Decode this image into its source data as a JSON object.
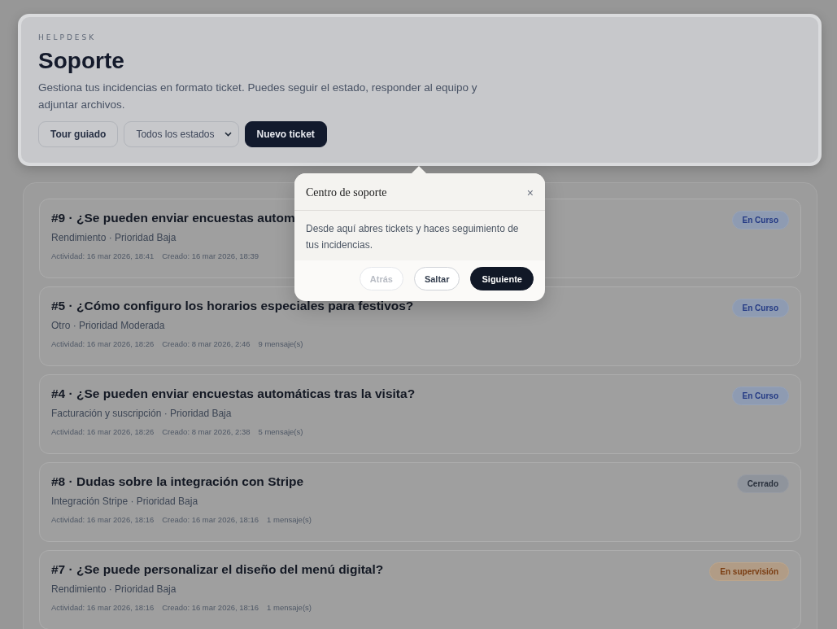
{
  "header": {
    "eyebrow": "HELPDESK",
    "title": "Soporte",
    "description": "Gestiona tus incidencias en formato ticket. Puedes seguir el estado, responder al equipo y adjuntar archivos.",
    "tour_button": "Tour guiado",
    "status_filter": {
      "value": "Todos los estados"
    },
    "new_button": "Nuevo ticket"
  },
  "tickets": [
    {
      "title": "#9 · ¿Se pueden enviar encuestas autom",
      "meta": "Rendimiento · Prioridad Baja",
      "activity": "Actividad: 16 mar 2026, 18:41",
      "created": "Creado: 16 mar 2026, 18:39",
      "status": {
        "label": "En Curso",
        "kind": "in_progress"
      }
    },
    {
      "title": "#5 · ¿Cómo configuro los horarios especiales para festivos?",
      "meta": "Otro · Prioridad Moderada",
      "activity": "Actividad: 16 mar 2026, 18:26",
      "created": "Creado: 8 mar 2026, 2:46",
      "messages": "9 mensaje(s)",
      "status": {
        "label": "En Curso",
        "kind": "in_progress"
      }
    },
    {
      "title": "#4 · ¿Se pueden enviar encuestas automáticas tras la visita?",
      "meta": "Facturación y suscripción · Prioridad Baja",
      "activity": "Actividad: 16 mar 2026, 18:26",
      "created": "Creado: 8 mar 2026, 2:38",
      "messages": "5 mensaje(s)",
      "status": {
        "label": "En Curso",
        "kind": "in_progress"
      }
    },
    {
      "title": "#8 · Dudas sobre la integración con Stripe",
      "meta": "Integración Stripe · Prioridad Baja",
      "activity": "Actividad: 16 mar 2026, 18:16",
      "created": "Creado: 16 mar 2026, 18:16",
      "messages": "1 mensaje(s)",
      "status": {
        "label": "Cerrado",
        "kind": "closed"
      }
    },
    {
      "title": "#7 · ¿Se puede personalizar el diseño del menú digital?",
      "meta": "Rendimiento · Prioridad Baja",
      "activity": "Actividad: 16 mar 2026, 18:16",
      "created": "Creado: 16 mar 2026, 18:16",
      "messages": "1 mensaje(s)",
      "status": {
        "label": "En supervisión",
        "kind": "review"
      }
    }
  ],
  "tour_popover": {
    "title": "Centro de soporte",
    "close": "×",
    "body": "Desde aquí abres tickets y haces seguimiento de tus incidencias.",
    "buttons": [
      {
        "label": "Atrás",
        "kind": "secondary",
        "disabled": true
      },
      {
        "label": "Saltar",
        "kind": "secondary",
        "disabled": false
      },
      {
        "label": "Siguiente",
        "kind": "primary",
        "disabled": false
      }
    ]
  }
}
